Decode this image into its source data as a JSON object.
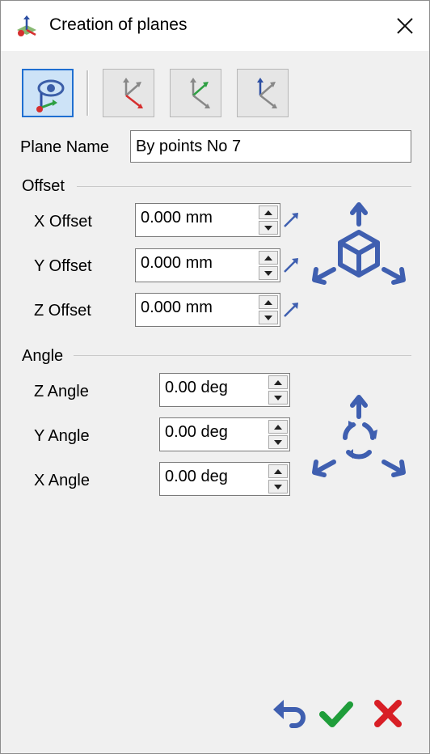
{
  "window": {
    "title": "Creation of planes"
  },
  "plane": {
    "label": "Plane Name",
    "value": "By points No 7"
  },
  "offset": {
    "group_label": "Offset",
    "rows": [
      {
        "label": "X Offset",
        "value": "0.000 mm"
      },
      {
        "label": "Y Offset",
        "value": "0.000 mm"
      },
      {
        "label": "Z Offset",
        "value": "0.000 mm"
      }
    ]
  },
  "angle": {
    "group_label": "Angle",
    "rows": [
      {
        "label": "Z Angle",
        "value": "0.00 deg"
      },
      {
        "label": "Y Angle",
        "value": "0.00 deg"
      },
      {
        "label": "X Angle",
        "value": "0.00 deg"
      }
    ]
  },
  "toolbar": {
    "buttons": [
      {
        "icon": "view-plane-icon",
        "active": true
      },
      {
        "icon": "axes-x-icon",
        "active": false
      },
      {
        "icon": "axes-y-icon",
        "active": false
      },
      {
        "icon": "axes-z-icon",
        "active": false
      }
    ]
  },
  "colors": {
    "accent": "#3f5fb0",
    "ok": "#1f9d3a",
    "cancel": "#d81f26"
  }
}
